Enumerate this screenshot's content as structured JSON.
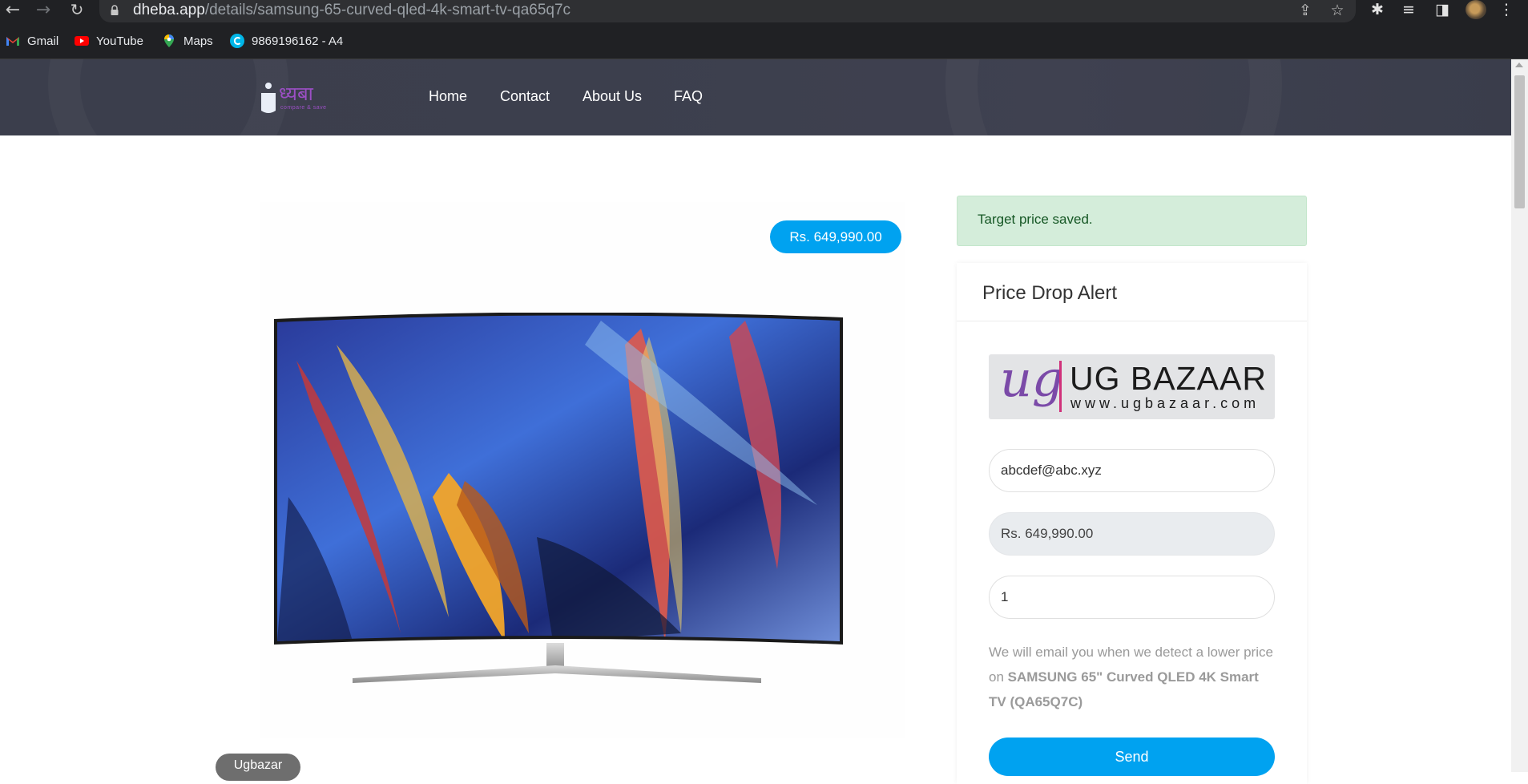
{
  "browser": {
    "url_host": "dheba.app",
    "url_path": "/details/samsung-65-curved-qled-4k-smart-tv-qa65q7c",
    "bookmarks": [
      "Gmail",
      "YouTube",
      "Maps",
      "9869196162 - A4"
    ]
  },
  "site": {
    "logo_text": "ध्यबा",
    "logo_tagline": "compare & save",
    "nav": [
      "Home",
      "Contact",
      "About Us",
      "FAQ"
    ]
  },
  "product": {
    "price": "Rs. 649,990.00",
    "store": "Ugbazar"
  },
  "alert": {
    "success_message": "Target price saved.",
    "title": "Price Drop Alert",
    "store_logo_text": "UG BAZAAR",
    "store_logo_url": "www.ugbazaar.com",
    "store_logo_mark": "ug",
    "email_value": "abcdef@abc.xyz",
    "price_value": "Rs. 649,990.00",
    "quantity_value": "1",
    "note_prefix": "We will email you when we detect a lower price on ",
    "note_product": "SAMSUNG 65\" Curved QLED 4K Smart TV (QA65Q7C)",
    "send_label": "Send"
  },
  "colors": {
    "accent": "#00a2f0",
    "header_bg": "#3c3f4d",
    "success_bg": "#d4edda",
    "success_text": "#155724"
  }
}
